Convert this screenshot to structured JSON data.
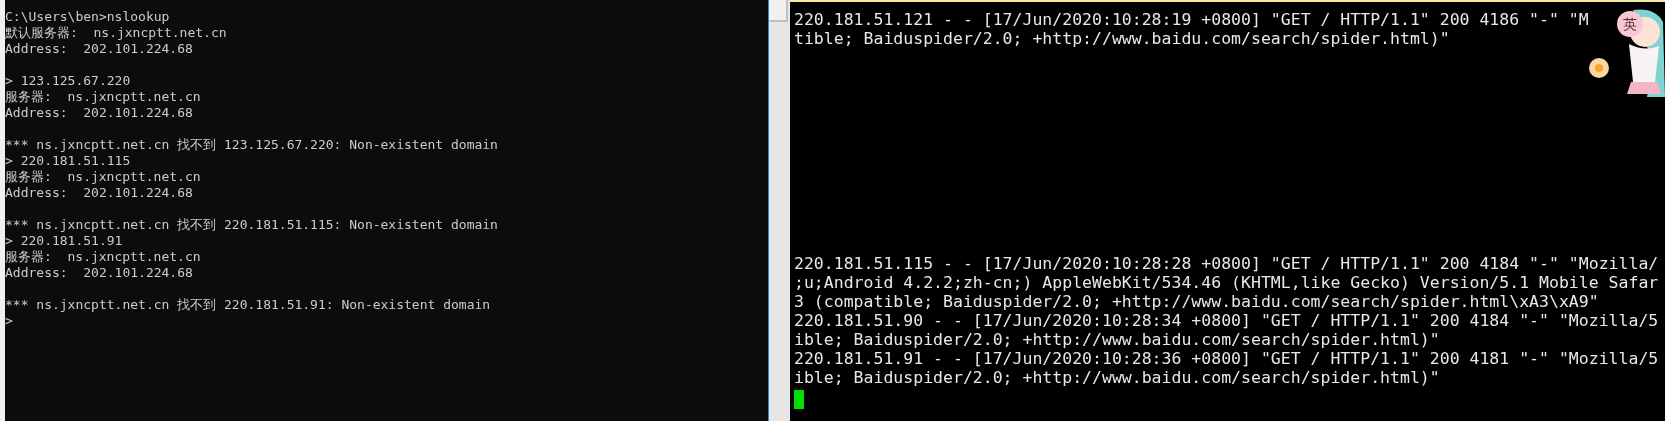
{
  "left_console": {
    "lines": [
      {
        "kind": "text",
        "text": "C:\\Users\\ben>nslookup"
      },
      {
        "kind": "text",
        "text": "默认服务器:  ns.jxncptt.net.cn"
      },
      {
        "kind": "text",
        "text": "Address:  202.101.224.68"
      },
      {
        "kind": "blank"
      },
      {
        "kind": "text",
        "text": "> 123.125.67.220"
      },
      {
        "kind": "text",
        "text": "服务器:  ns.jxncptt.net.cn"
      },
      {
        "kind": "text",
        "text": "Address:  202.101.224.68"
      },
      {
        "kind": "blank"
      },
      {
        "kind": "text",
        "text": "*** ns.jxncptt.net.cn 找不到 123.125.67.220: Non-existent domain"
      },
      {
        "kind": "text",
        "text": "> 220.181.51.115"
      },
      {
        "kind": "text",
        "text": "服务器:  ns.jxncptt.net.cn"
      },
      {
        "kind": "text",
        "text": "Address:  202.101.224.68"
      },
      {
        "kind": "blank"
      },
      {
        "kind": "text",
        "text": "*** ns.jxncptt.net.cn 找不到 220.181.51.115: Non-existent domain"
      },
      {
        "kind": "text",
        "text": "> 220.181.51.91"
      },
      {
        "kind": "text",
        "text": "服务器:  ns.jxncptt.net.cn"
      },
      {
        "kind": "text",
        "text": "Address:  202.101.224.68"
      },
      {
        "kind": "blank"
      },
      {
        "kind": "text",
        "text": "*** ns.jxncptt.net.cn 找不到 220.181.51.91: Non-existent domain"
      },
      {
        "kind": "text",
        "text": ">"
      }
    ]
  },
  "right_terminal": {
    "top_lines": [
      "220.181.51.121 - - [17/Jun/2020:10:28:19 +0800] \"GET / HTTP/1.1\" 200 4186 \"-\" \"M",
      "tible; Baiduspider/2.0; +http://www.baidu.com/search/spider.html)\""
    ],
    "bottom_lines": [
      "220.181.51.115 - - [17/Jun/2020:10:28:28 +0800] \"GET / HTTP/1.1\" 200 4184 \"-\" \"Mozilla/",
      ";u;Android 4.2.2;zh-cn;) AppleWebKit/534.46 (KHTML,like Gecko) Version/5.1 Mobile Safar",
      "3 (compatible; Baiduspider/2.0; +http://www.baidu.com/search/spider.html\\xA3\\xA9\"",
      "220.181.51.90 - - [17/Jun/2020:10:28:34 +0800] \"GET / HTTP/1.1\" 200 4184 \"-\" \"Mozilla/5",
      "ible; Baiduspider/2.0; +http://www.baidu.com/search/spider.html)\"",
      "220.181.51.91 - - [17/Jun/2020:10:28:36 +0800] \"GET / HTTP/1.1\" 200 4181 \"-\" \"Mozilla/5",
      "ible; Baiduspider/2.0; +http://www.baidu.com/search/spider.html)\""
    ]
  },
  "ime_badge": {
    "label": "英"
  }
}
